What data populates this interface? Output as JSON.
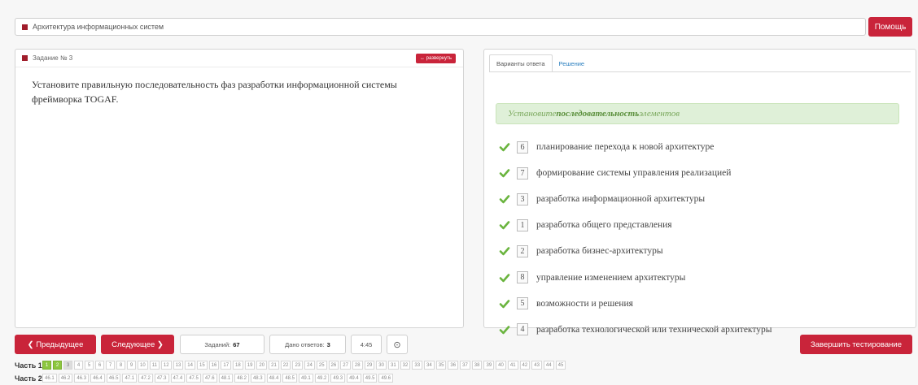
{
  "topbar": {
    "breadcrumb": "Архитектура информационных систем",
    "help": "Помощь"
  },
  "task": {
    "title": "Задание № 3",
    "expand": "↔ развернуть",
    "text": "Установите правильную последовательность фаз разработки информационной системы фреймворка TOGAF."
  },
  "answers": {
    "tabs": [
      "Варианты ответа",
      "Решение"
    ],
    "notice_prefix": "Установите ",
    "notice_bold": "последовательность",
    "notice_suffix": " элементов",
    "items": [
      {
        "num": "6",
        "text": "планирование перехода к новой архитектуре"
      },
      {
        "num": "7",
        "text": "формирование системы управления реализацией"
      },
      {
        "num": "3",
        "text": "разработка информационной архитектуры"
      },
      {
        "num": "1",
        "text": "разработка общего представления"
      },
      {
        "num": "2",
        "text": "разработка бизнес-архитектуры"
      },
      {
        "num": "8",
        "text": "управление изменением архитектуры"
      },
      {
        "num": "5",
        "text": "возможности и решения"
      },
      {
        "num": "4",
        "text": "разработка технологической или технической архитектуры"
      }
    ]
  },
  "footer": {
    "prev": "❮ Предыдущее",
    "next": "Следующее ❯",
    "tasks_label": "Заданий:",
    "tasks_count": "67",
    "answered_label": "Дано ответов:",
    "answered_count": "3",
    "timer": "4:45",
    "finish": "Завершить тестирование"
  },
  "parts": [
    {
      "label": "Часть 1",
      "cells": [
        "1",
        "2",
        "3",
        "4",
        "5",
        "6",
        "7",
        "8",
        "9",
        "10",
        "11",
        "12",
        "13",
        "14",
        "15",
        "16",
        "17",
        "18",
        "19",
        "20",
        "21",
        "22",
        "23",
        "24",
        "25",
        "26",
        "27",
        "28",
        "29",
        "30",
        "31",
        "32",
        "33",
        "34",
        "35",
        "36",
        "37",
        "38",
        "39",
        "40",
        "41",
        "42",
        "43",
        "44",
        "45"
      ]
    },
    {
      "label": "Часть 2",
      "cells": [
        "46.1",
        "46.2",
        "46.3",
        "46.4",
        "46.5",
        "47.1",
        "47.2",
        "47.3",
        "47.4",
        "47.5",
        "47.6",
        "48.1",
        "48.2",
        "48.3",
        "48.4",
        "48.5",
        "49.1",
        "49.2",
        "49.3",
        "49.4",
        "49.5",
        "49.6"
      ]
    }
  ],
  "colors": {
    "accent": "#c9243a",
    "answered": "#8cc63f",
    "current": "#dddddd"
  }
}
